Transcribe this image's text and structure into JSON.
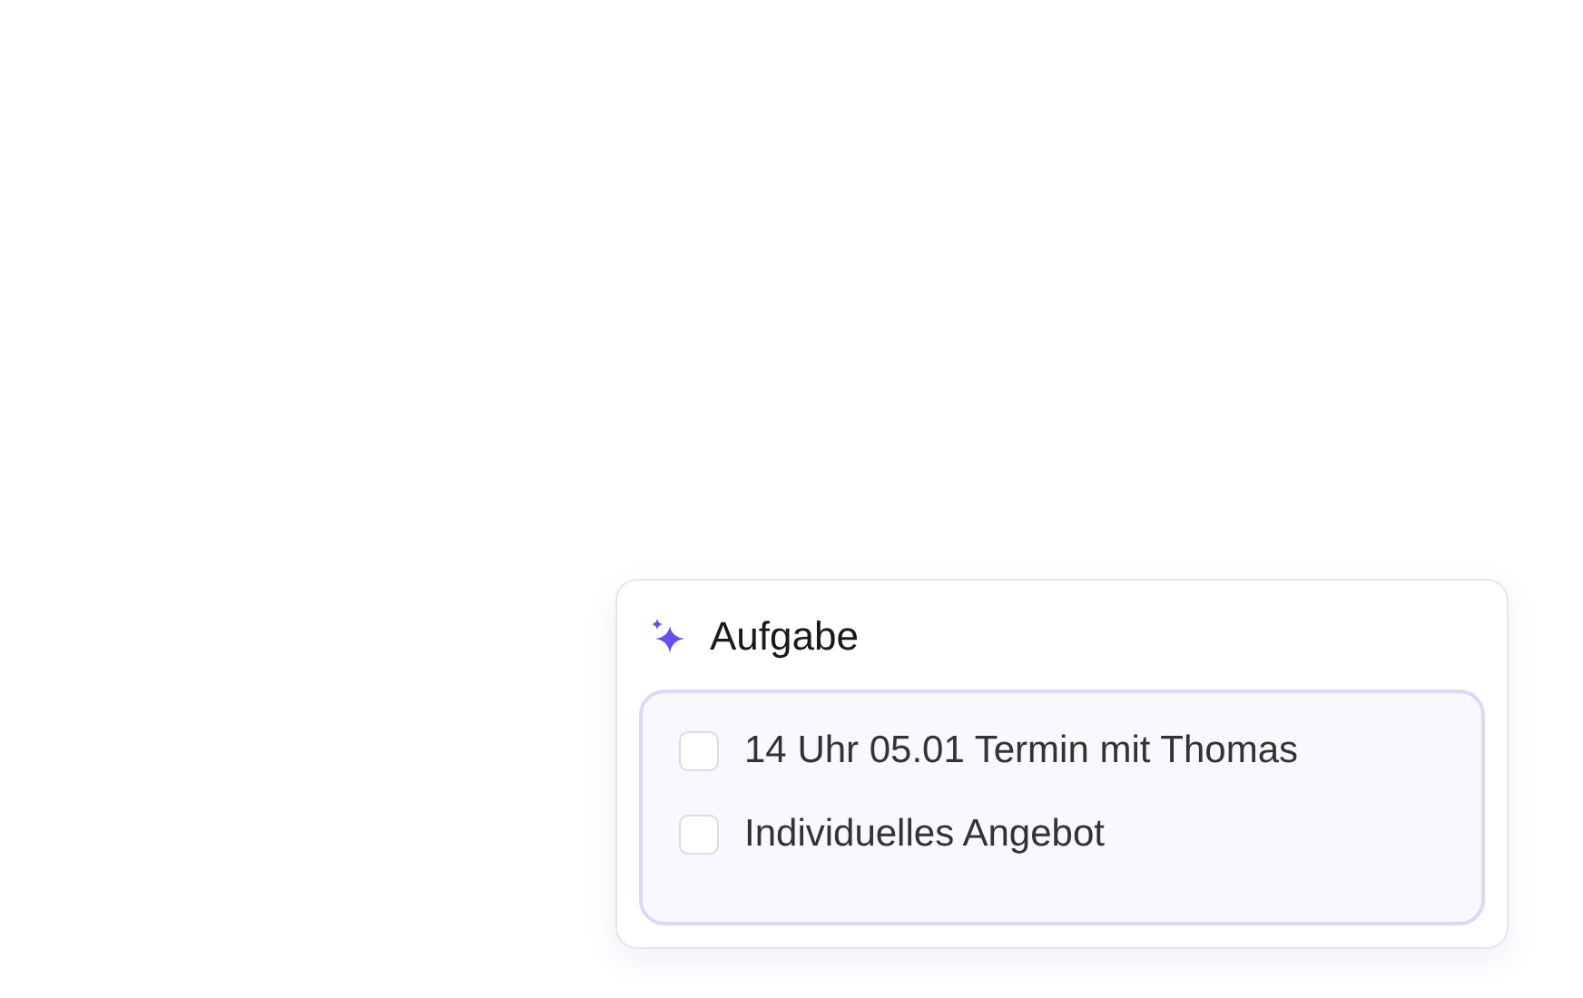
{
  "card": {
    "title": "Aufgabe",
    "tasks": [
      {
        "label": "14 Uhr 05.01 Termin mit Thomas",
        "checked": false
      },
      {
        "label": "Individuelles Angebot",
        "checked": false
      }
    ]
  }
}
